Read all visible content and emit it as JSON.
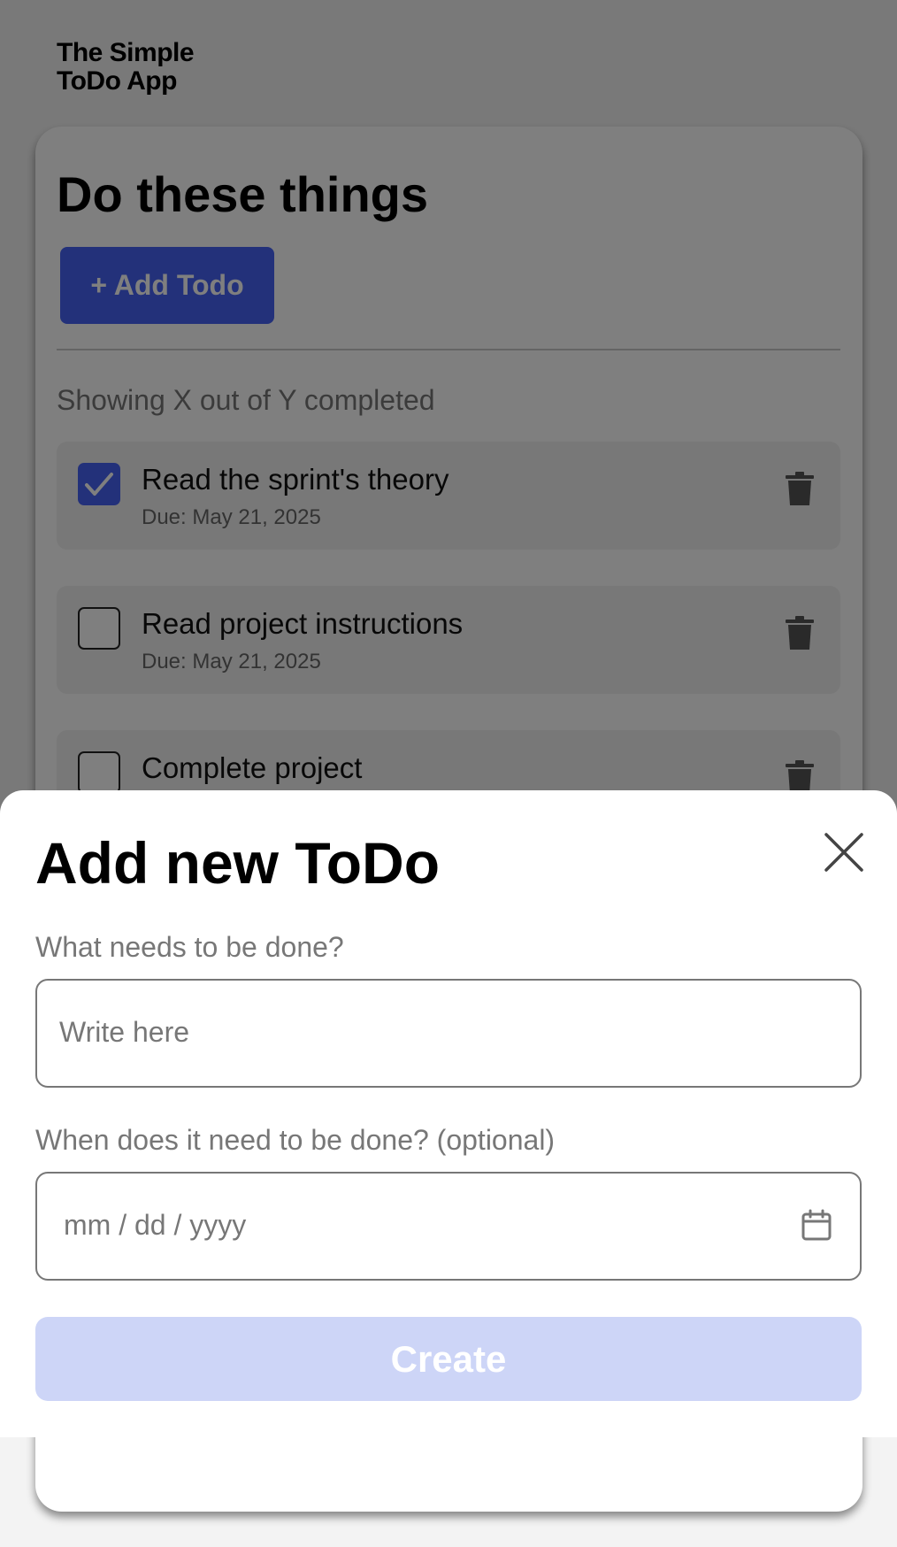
{
  "app": {
    "title_line1": "The Simple",
    "title_line2": "ToDo App"
  },
  "main": {
    "title": "Do these things",
    "add_button_label": "+ Add Todo",
    "showing_text": "Showing X out of Y completed",
    "todos": [
      {
        "title": "Read the sprint's theory",
        "due": "Due: May 21, 2025",
        "completed": true
      },
      {
        "title": "Read project instructions",
        "due": "Due: May 21, 2025",
        "completed": false
      },
      {
        "title": "Complete project",
        "due": "",
        "completed": false
      }
    ]
  },
  "modal": {
    "title": "Add new ToDo",
    "field1_label": "What needs to be done?",
    "field1_placeholder": "Write here",
    "field2_label": "When does it need to be done? (optional)",
    "field2_placeholder": "mm / dd / yyyy",
    "create_label": "Create"
  },
  "colors": {
    "accent": "#4763f5",
    "accent_disabled": "#cdd5f7"
  }
}
